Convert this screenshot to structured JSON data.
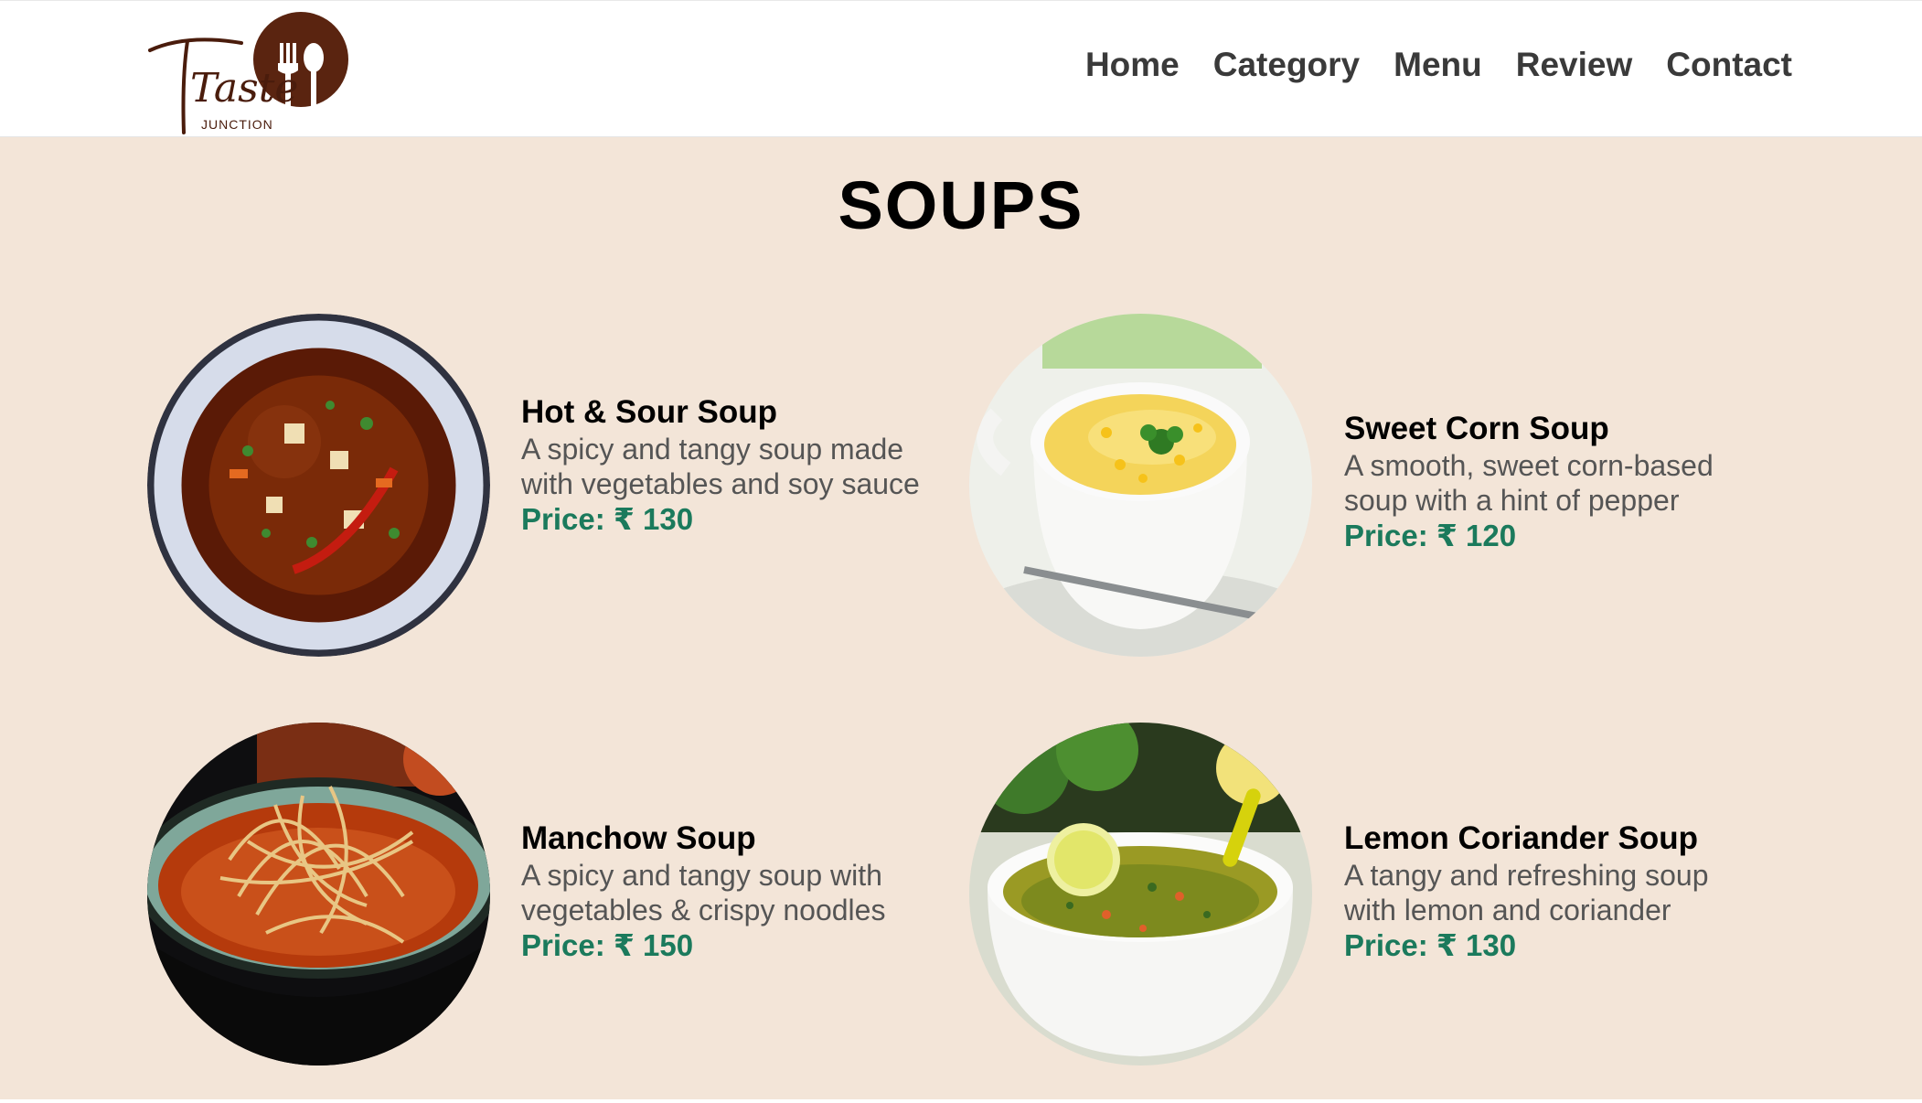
{
  "brand": {
    "logo_text": "Taste",
    "logo_subtext": "JUNCTION",
    "logo_color": "#5a2410"
  },
  "nav": {
    "items": [
      "Home",
      "Category",
      "Menu",
      "Review",
      "Contact"
    ]
  },
  "section": {
    "title": "SOUPS"
  },
  "colors": {
    "background": "#f3e5d8",
    "price": "#1b7a5c",
    "nav_text": "#3a3a3a"
  },
  "menu_items": [
    {
      "name": "Hot & Sour Soup",
      "description": "A spicy and tangy soup made with vegetables and soy sauce",
      "price": "Price: ₹ 130",
      "image_icon": "hot-sour-soup-image"
    },
    {
      "name": "Sweet Corn Soup",
      "description": "A smooth, sweet corn-based soup with a hint of pepper",
      "price": "Price: ₹ 120",
      "image_icon": "sweet-corn-soup-image"
    },
    {
      "name": "Manchow Soup",
      "description": "A spicy and tangy soup with vegetables & crispy noodles",
      "price": "Price: ₹ 150",
      "image_icon": "manchow-soup-image"
    },
    {
      "name": "Lemon Coriander Soup",
      "description": "A tangy and refreshing soup with lemon and coriander",
      "price": "Price: ₹ 130",
      "image_icon": "lemon-coriander-soup-image"
    }
  ]
}
